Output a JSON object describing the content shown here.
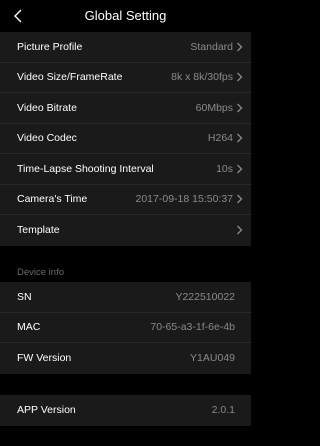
{
  "header": {
    "title": "Global Setting"
  },
  "icons": {
    "back": "chevron-left-icon",
    "chevron": "chevron-right-icon"
  },
  "settings": [
    {
      "label": "Picture Profile",
      "value": "Standard"
    },
    {
      "label": "Video Size/FrameRate",
      "value": "8k x 8k/30fps"
    },
    {
      "label": "Video Bitrate",
      "value": "60Mbps"
    },
    {
      "label": "Video Codec",
      "value": "H264"
    },
    {
      "label": "Time-Lapse Shooting Interval",
      "value": "10s"
    },
    {
      "label": "Camera's Time",
      "value": "2017-09-18 15:50:37"
    },
    {
      "label": "Template",
      "value": ""
    }
  ],
  "device_info": {
    "header": "Device info",
    "items": [
      {
        "label": "SN",
        "value": "Y222510022"
      },
      {
        "label": "MAC",
        "value": "70-65-a3-1f-6e-4b"
      },
      {
        "label": "FW Version",
        "value": "Y1AU049"
      }
    ]
  },
  "app": {
    "label": "APP Version",
    "value": "2.0.1"
  },
  "colors": {
    "background": "#000000",
    "cell": "#1a1a1a",
    "value_text": "#8a8a8a",
    "section_header": "#6a6a6a"
  }
}
